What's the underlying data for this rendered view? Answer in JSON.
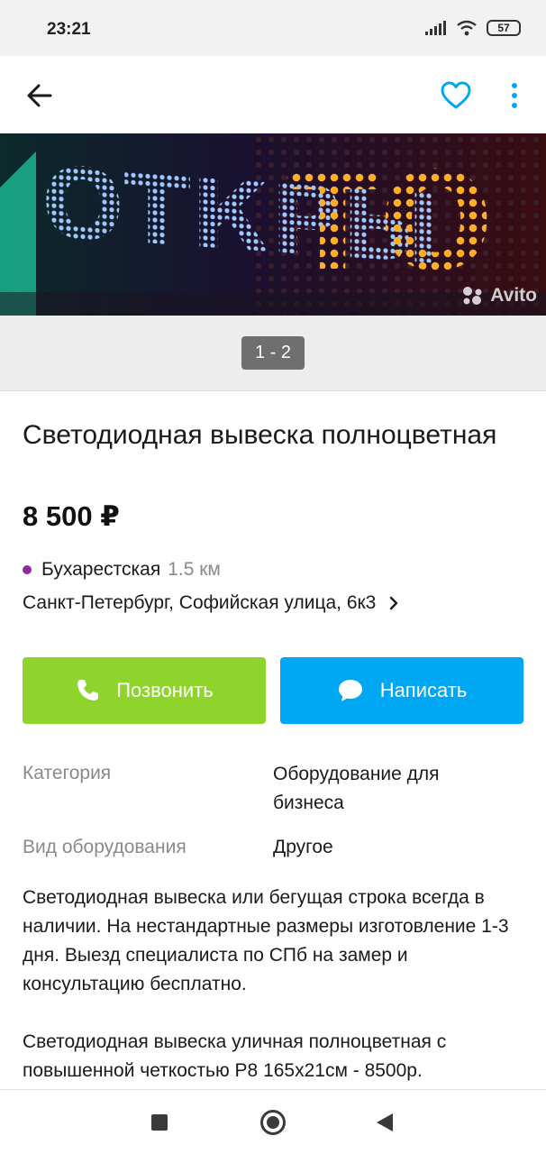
{
  "status_bar": {
    "time": "23:21",
    "battery": "57"
  },
  "photo": {
    "sign_text": "ОТКРЫТО",
    "watermark": "Avito",
    "counter": "1 - 2"
  },
  "listing": {
    "title": "Светодиодная вывеска полноцветная",
    "price": "8 500 ₽",
    "metro_station": "Бухарестская",
    "metro_distance": "1.5 км",
    "address": "Санкт-Петербург, Софийская улица, 6к3"
  },
  "actions": {
    "call_label": "Позвонить",
    "write_label": "Написать"
  },
  "params": [
    {
      "label": "Категория",
      "value": "Оборудование для бизнеса"
    },
    {
      "label": "Вид оборудования",
      "value": "Другое"
    }
  ],
  "description": "Светодиодная вывеска или бегущая строка всегда в наличии. На нестандартные размеры изготовление 1-3 дня. Выезд специалиста по СПб на замер и консультацию бесплатно.\n\nСветодиодная вывеска уличная полноцветная с повышенной четкостью P8 165х21см - 8500р.",
  "colors": {
    "call_button": "#8ed42c",
    "write_button": "#00a8f4",
    "favorite_icon": "#00a8f4",
    "metro_dot": "#8e2c9e"
  },
  "icons": [
    "arrow-left-icon",
    "heart-icon",
    "more-vertical-icon",
    "chevron-right-icon",
    "phone-icon",
    "chat-bubble-icon"
  ]
}
